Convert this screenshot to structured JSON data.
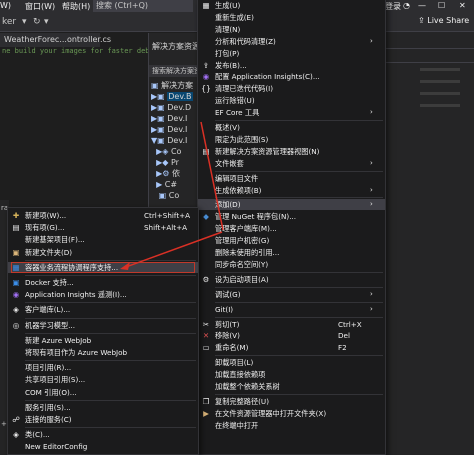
{
  "menubar": {
    "app_icon": "vs-logo-icon",
    "items": [
      "W)",
      "窗口(W)",
      "帮助(H)"
    ],
    "search": "搜索 (Ctrl+Q)",
    "login": "登录",
    "live_share": "Live Share"
  },
  "toolbar": {
    "left_label": "ker"
  },
  "editor": {
    "tab": "WeatherForec...ontroller.cs",
    "hint": "ne build your images for faster debugging."
  },
  "solution_explorer": {
    "title": "解决方案资源管",
    "search": "搜索解决方案资源管",
    "solution_row": "解决方案",
    "rows": [
      "Dev.B",
      "Dev.D",
      "Dev.I",
      "Dev.I",
      "Dev.I",
      "Co",
      "Pr",
      "依",
      "C#",
      "Co"
    ]
  },
  "left_strip": [
    "ra",
    "+"
  ],
  "main_menu": {
    "items": [
      {
        "icon": "build-icon",
        "label": "生成(U)"
      },
      {
        "icon": "",
        "label": "重新生成(E)"
      },
      {
        "icon": "",
        "label": "清理(N)"
      },
      {
        "icon": "",
        "label": "分析和代码清理(Z)",
        "submenu": true
      },
      {
        "icon": "",
        "label": "打包(P)"
      },
      {
        "icon": "publish-icon",
        "label": "发布(B)..."
      },
      {
        "icon": "insights-icon",
        "label": "配置 Application Insights(C)..."
      },
      {
        "icon": "code-cleanup-icon",
        "label": "清理已迭代代码(I)"
      },
      {
        "icon": "",
        "label": "运行除错(U)"
      },
      {
        "icon": "",
        "label": "EF Core 工具",
        "submenu": true
      },
      {
        "icon": "",
        "label": "概述(V)"
      },
      {
        "icon": "",
        "label": "限定为此范围(S)"
      },
      {
        "icon": "new-view-icon",
        "label": "新建解决方案资源管理器视图(N)"
      },
      {
        "icon": "",
        "label": "文件嵌套",
        "submenu": true
      },
      {
        "icon": "",
        "label": "编辑项目文件"
      },
      {
        "icon": "",
        "label": "生成依赖项(B)",
        "submenu": true
      },
      {
        "icon": "",
        "label": "添加(D)",
        "submenu": true,
        "highlighted": true
      },
      {
        "icon": "nuget-icon",
        "label": "管理 NuGet 程序包(N)..."
      },
      {
        "icon": "",
        "label": "管理客户端库(M)..."
      },
      {
        "icon": "",
        "label": "管理用户机密(G)"
      },
      {
        "icon": "",
        "label": "删除未使用的引用..."
      },
      {
        "icon": "",
        "label": "同步命名空间(Y)"
      },
      {
        "icon": "gear-icon",
        "label": "设为启动项目(A)"
      },
      {
        "icon": "",
        "label": "调试(G)",
        "submenu": true
      },
      {
        "icon": "",
        "label": "Git(I)",
        "submenu": true
      },
      {
        "icon": "cut-icon",
        "label": "剪切(T)",
        "shortcut": "Ctrl+X"
      },
      {
        "icon": "close-icon",
        "label": "移除(V)",
        "shortcut": "Del"
      },
      {
        "icon": "rename-icon",
        "label": "重命名(M)",
        "shortcut": "F2"
      },
      {
        "icon": "",
        "label": "卸载项目(L)"
      },
      {
        "icon": "",
        "label": "加载直接依赖项"
      },
      {
        "icon": "",
        "label": "加载整个依赖关系树"
      },
      {
        "icon": "copy-icon",
        "label": "复制完整路径(U)"
      },
      {
        "icon": "folder-icon",
        "label": "在文件资源管理器中打开文件夹(X)"
      },
      {
        "icon": "",
        "label": "在终端中打开"
      }
    ]
  },
  "sub_menu": {
    "items": [
      {
        "icon": "new-item-icon",
        "label": "新建项(W)...",
        "shortcut": "Ctrl+Shift+A"
      },
      {
        "icon": "existing-item-icon",
        "label": "现有项(G)...",
        "shortcut": "Shift+Alt+A"
      },
      {
        "icon": "",
        "label": "新建基架项目(F)..."
      },
      {
        "icon": "new-folder-icon",
        "label": "新建文件夹(D)"
      },
      {
        "icon": "container-icon",
        "label": "容器业务流程协调程序支持...",
        "highlighted": true
      },
      {
        "icon": "docker-icon",
        "label": "Docker 支持..."
      },
      {
        "icon": "insights-icon",
        "label": "Application Insights 遥测(I)..."
      },
      {
        "icon": "client-lib-icon",
        "label": "客户端库(L)..."
      },
      {
        "icon": "ml-icon",
        "label": "机器学习模型..."
      },
      {
        "icon": "",
        "label": "新建 Azure WebJob"
      },
      {
        "icon": "",
        "label": "将现有项目作为 Azure WebJob"
      },
      {
        "icon": "",
        "label": "项目引用(R)..."
      },
      {
        "icon": "",
        "label": "共享项目引用(S)..."
      },
      {
        "icon": "",
        "label": "COM 引用(O)..."
      },
      {
        "icon": "",
        "label": "服务引用(S)..."
      },
      {
        "icon": "connected-service-icon",
        "label": "连接的服务(C)"
      },
      {
        "icon": "class-icon",
        "label": "类(C)..."
      },
      {
        "icon": "",
        "label": "New EditorConfig"
      }
    ]
  },
  "colors": {
    "menu_bg": "#1b1b1c",
    "highlight": "#3f3f46",
    "annotation_red": "#d93025"
  }
}
